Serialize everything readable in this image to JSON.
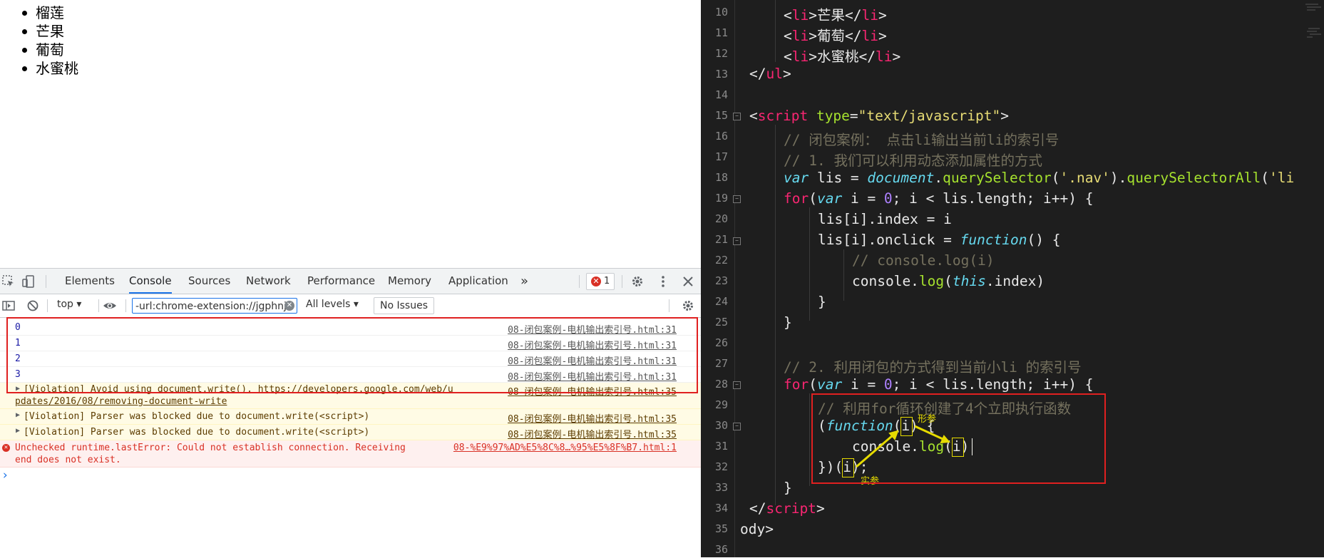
{
  "page": {
    "fruits": [
      "榴莲",
      "芒果",
      "葡萄",
      "水蜜桃"
    ]
  },
  "devtools": {
    "tabs": [
      "Elements",
      "Console",
      "Sources",
      "Network",
      "Performance",
      "Memory",
      "Application"
    ],
    "active_tab": "Console",
    "more_tabs": "»",
    "error_count": "1",
    "context": "top",
    "filter_value": "-url:chrome-extension://jgphnj",
    "levels": "All levels",
    "issues": "No Issues",
    "icons": [
      "inspect-icon",
      "device-toolbar-icon",
      "sidebar-icon",
      "clear-icon",
      "eye-icon",
      "gear-icon",
      "kebab-icon",
      "close-icon"
    ]
  },
  "console": {
    "logs": [
      {
        "value": "0",
        "source": "08-闭包案例-电机输出索引号.html:31"
      },
      {
        "value": "1",
        "source": "08-闭包案例-电机输出索引号.html:31"
      },
      {
        "value": "2",
        "source": "08-闭包案例-电机输出索引号.html:31"
      },
      {
        "value": "3",
        "source": "08-闭包案例-电机输出索引号.html:31"
      }
    ],
    "warn1": {
      "line1_prefix": "[Violation] Avoid using document.write(). ",
      "line1_link": "https://developers.google.com/web/u",
      "line2_link": "pdates/2016/08/removing-document-write",
      "source": "08-闭包案例-电机输出索引号.html:35"
    },
    "warn2": {
      "message": "[Violation] Parser was blocked due to document.write(<script>)",
      "source": "08-闭包案例-电机输出索引号.html:35"
    },
    "warn3": {
      "message": "[Violation] Parser was blocked due to document.write(<script>)",
      "source": "08-闭包案例-电机输出索引号.html:35"
    },
    "error": {
      "line1": "Unchecked runtime.lastError: Could not establish connection. Receiving",
      "line2": "end does not exist.",
      "source": "08-%E9%97%AD%E5%8C%8…%95%E5%8F%B7.html:1"
    },
    "prompt": "›"
  },
  "editor": {
    "line_numbers": [
      "10",
      "11",
      "12",
      "13",
      "14",
      "15",
      "16",
      "17",
      "18",
      "19",
      "20",
      "21",
      "22",
      "23",
      "24",
      "25",
      "26",
      "27",
      "28",
      "29",
      "30",
      "31",
      "32",
      "33",
      "34",
      "35",
      "36"
    ],
    "annotations": {
      "formal_param": "形参",
      "actual_param": "实参"
    }
  }
}
